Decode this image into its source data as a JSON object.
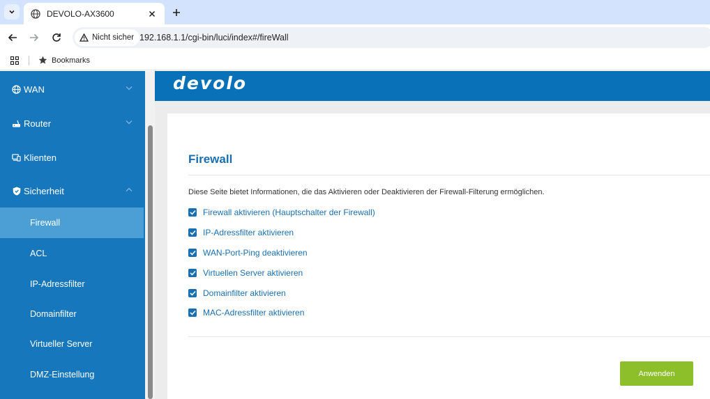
{
  "browser": {
    "tab_title": "DEVOLO-AX3600",
    "security_label": "Nicht sicher",
    "url": "192.168.1.1/cgi-bin/luci/index#/fireWall",
    "bookmarks_label": "Bookmarks"
  },
  "brand": {
    "logo_text": "devolo"
  },
  "sidebar": {
    "items": [
      {
        "label": "WAN",
        "icon": "globe-icon"
      },
      {
        "label": "Router",
        "icon": "router-icon"
      },
      {
        "label": "Klienten",
        "icon": "devices-icon"
      },
      {
        "label": "Sicherheit",
        "icon": "shield-icon"
      }
    ],
    "sub_items": [
      {
        "label": "Firewall",
        "active": true
      },
      {
        "label": "ACL"
      },
      {
        "label": "IP-Adressfilter"
      },
      {
        "label": "Domainfilter"
      },
      {
        "label": "Virtueller Server"
      },
      {
        "label": "DMZ-Einstellung"
      }
    ]
  },
  "main": {
    "title": "Firewall",
    "description": "Diese Seite bietet Informationen, die das Aktivieren oder Deaktivieren der Firewall-Filterung ermöglichen.",
    "options": [
      {
        "label": "Firewall aktivieren (Hauptschalter der Firewall)",
        "checked": true
      },
      {
        "label": "IP-Adressfilter aktivieren",
        "checked": true
      },
      {
        "label": "WAN-Port-Ping deaktivieren",
        "checked": true
      },
      {
        "label": "Virtuellen Server aktivieren",
        "checked": true
      },
      {
        "label": "Domainfilter aktivieren",
        "checked": true
      },
      {
        "label": "MAC-Adressfilter aktivieren",
        "checked": true
      }
    ],
    "apply_label": "Anwenden"
  },
  "colors": {
    "sidebar": "#1677bc",
    "sidebar_active": "#4b9fd5",
    "brand_bar": "#0971b8",
    "accent_text": "#1a6fb0",
    "apply_button": "#8dbf2b"
  }
}
